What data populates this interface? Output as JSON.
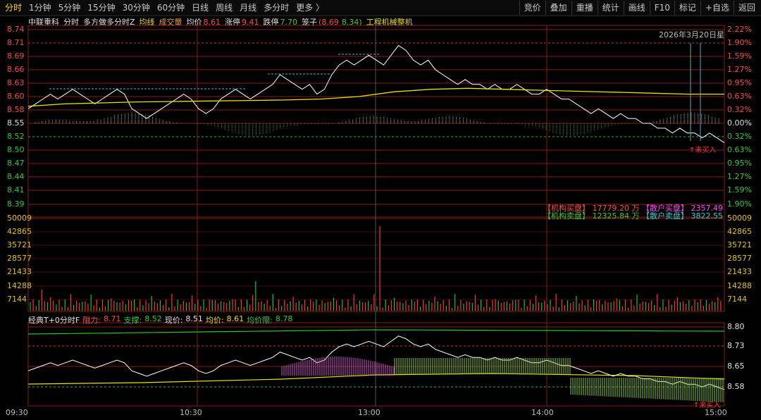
{
  "toolbar": {
    "periods": [
      "分时",
      "1分钟",
      "5分钟",
      "15分钟",
      "30分钟",
      "60分钟",
      "日线",
      "周线",
      "月线",
      "多分时",
      "更多 〉"
    ],
    "actions": [
      "竞价",
      "叠加",
      "重播",
      "统计",
      "画线",
      "F10",
      "标记",
      "+自选",
      "返回"
    ]
  },
  "info": {
    "stock_name": "中联重科",
    "chart_kind": "分时",
    "mode": "多方做多分时Z",
    "avg_label": "均线",
    "vol_label": "成交量",
    "price_label": "均价",
    "price_value": "8.61",
    "limit_up_label": "涨停",
    "limit_up_value": "9.41",
    "limit_down_label": "跌停",
    "limit_down_value": "7.70",
    "box_label": "笼子",
    "box_value_high": "(8.69",
    "box_value_low": "8.34)",
    "industry": "工程机械整机"
  },
  "date_text": "2026年3月20日星",
  "price_axis": {
    "left": [
      "8.74",
      "8.71",
      "8.69",
      "8.66",
      "8.63",
      "8.60",
      "8.58",
      "8.55",
      "8.52",
      "8.50",
      "8.47",
      "8.44",
      "8.41",
      "8.39"
    ],
    "right": [
      "2.22%",
      "1.90%",
      "1.59%",
      "1.27%",
      "0.95%",
      "0.63%",
      "0.32%",
      "0.00%",
      "0.32%",
      "0.63%",
      "0.95%",
      "1.27%",
      "1.59%",
      "1.90%"
    ]
  },
  "flows": {
    "inst_buy_label": "【机构买盘】",
    "inst_buy_value": "17779.20 万",
    "retail_buy_label": "【散户买盘】",
    "retail_buy_value": "2357.49",
    "inst_sell_label": "【机构卖盘】",
    "inst_sell_value": "12325.84 万",
    "retail_sell_label": "【散户卖盘】",
    "retail_sell_value": "3822.55"
  },
  "volume_axis": [
    "50009",
    "42865",
    "35721",
    "28577",
    "21433",
    "14288",
    "7144"
  ],
  "indicator": {
    "name": "经典T+0分时F",
    "resistance_label": "阻力:",
    "resistance_value": "8.71",
    "support_label": "支撑:",
    "support_value": "8.52",
    "now_label": "现价:",
    "now_value": "8.51",
    "avg_label": "均价:",
    "avg_value": "8.61",
    "avglimit_label": "均价限:",
    "avglimit_value": "8.78",
    "axis": [
      "8.80",
      "8.73",
      "8.65",
      "8.58"
    ]
  },
  "signal_text": "↑来买入",
  "signal_text_bottom": "↑来买入",
  "time_axis": [
    "09:30",
    "10:30",
    "13:00",
    "14:00",
    "15:00"
  ],
  "colors": {
    "up": "#ff3333",
    "down": "#00cc33",
    "avg": "#e8e000",
    "grid": "#8b1a1a",
    "price": "#ffffff"
  }
}
